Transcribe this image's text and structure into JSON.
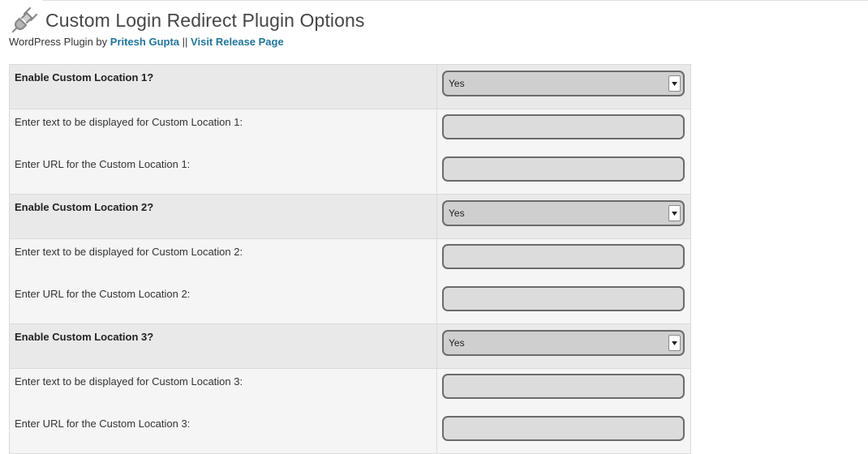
{
  "header": {
    "icon": "plug-icon",
    "title": "Custom Login Redirect Plugin Options"
  },
  "byline": {
    "prefix": "WordPress Plugin by",
    "author_link": "Pritesh Gupta",
    "separator": "||",
    "release_link": "Visit Release Page"
  },
  "locations": [
    {
      "enable_label": "Enable Custom Location 1?",
      "enable_value": "Yes",
      "text_label": "Enter text to be displayed for Custom Location 1:",
      "text_value": "",
      "url_label": "Enter URL for the Custom Location 1:",
      "url_value": ""
    },
    {
      "enable_label": "Enable Custom Location 2?",
      "enable_value": "Yes",
      "text_label": "Enter text to be displayed for Custom Location 2:",
      "text_value": "",
      "url_label": "Enter URL for the Custom Location 2:",
      "url_value": ""
    },
    {
      "enable_label": "Enable Custom Location 3?",
      "enable_value": "Yes",
      "text_label": "Enter text to be displayed for Custom Location 3:",
      "text_value": "",
      "url_label": "Enter URL for the Custom Location 3:",
      "url_value": ""
    }
  ],
  "colors": {
    "link": "#21759b",
    "title": "#464646",
    "enable_row_bg": "#e9e9e9",
    "field_row_bg": "#f5f5f5",
    "input_bg": "#dcdcdc",
    "select_bg": "#cfcfcf"
  }
}
